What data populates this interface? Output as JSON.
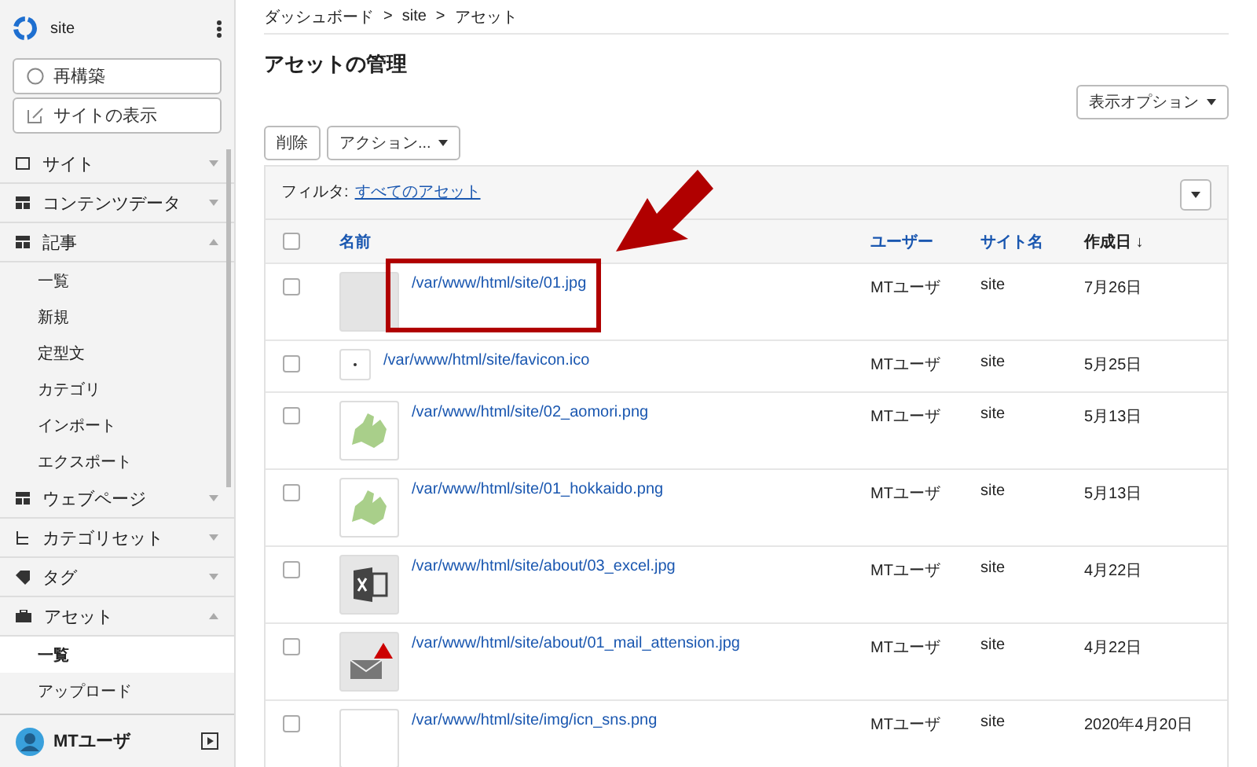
{
  "sidebar": {
    "site_name": "site",
    "buttons": [
      {
        "kind": "rebuild",
        "label": "再構築"
      },
      {
        "kind": "view",
        "label": "サイトの表示"
      }
    ],
    "items": [
      {
        "label": "サイト",
        "kind": "window",
        "expanded": false
      },
      {
        "label": "コンテンツデータ",
        "kind": "grid",
        "expanded": false
      },
      {
        "label": "記事",
        "kind": "grid",
        "expanded": true,
        "children": [
          {
            "label": "一覧",
            "selected": false
          },
          {
            "label": "新規",
            "selected": false
          },
          {
            "label": "定型文",
            "selected": false
          },
          {
            "label": "カテゴリ",
            "selected": false
          },
          {
            "label": "インポート",
            "selected": false
          },
          {
            "label": "エクスポート",
            "selected": false
          }
        ]
      },
      {
        "label": "ウェブページ",
        "kind": "grid",
        "expanded": false
      },
      {
        "label": "カテゴリセット",
        "kind": "tree",
        "expanded": false
      },
      {
        "label": "タグ",
        "kind": "tag",
        "expanded": false
      },
      {
        "label": "アセット",
        "kind": "briefcase",
        "expanded": true,
        "children": [
          {
            "label": "一覧",
            "selected": true
          },
          {
            "label": "アップロード",
            "selected": false
          }
        ]
      }
    ],
    "user": "MTユーザ"
  },
  "breadcrumb": [
    "ダッシュボード",
    "site",
    "アセット"
  ],
  "breadcrumb_separator": ">",
  "title": "アセットの管理",
  "display_options": "表示オプション",
  "actions": {
    "delete": "削除",
    "menu": "アクション..."
  },
  "filter": {
    "label": "フィルタ:",
    "value": "すべてのアセット"
  },
  "table": {
    "header_checked": false,
    "columns": [
      {
        "label": "名前",
        "link": true
      },
      {
        "label": "ユーザー",
        "link": true
      },
      {
        "label": "サイト名",
        "link": true
      },
      {
        "label": "作成日",
        "link": false,
        "sort": "↓"
      }
    ],
    "rows": [
      {
        "kind": "sample",
        "name": "/var/www/html/site/01.jpg",
        "user": "MTユーザ",
        "site": "site",
        "date": "7月26日",
        "checked": false
      },
      {
        "kind": "dot",
        "name": "/var/www/html/site/favicon.ico",
        "user": "MTユーザ",
        "site": "site",
        "date": "5月25日",
        "checked": false
      },
      {
        "kind": "map",
        "name": "/var/www/html/site/02_aomori.png",
        "user": "MTユーザ",
        "site": "site",
        "date": "5月13日",
        "checked": false
      },
      {
        "kind": "map",
        "name": "/var/www/html/site/01_hokkaido.png",
        "user": "MTユーザ",
        "site": "site",
        "date": "5月13日",
        "checked": false
      },
      {
        "kind": "excel",
        "name": "/var/www/html/site/about/03_excel.jpg",
        "user": "MTユーザ",
        "site": "site",
        "date": "4月22日",
        "checked": false
      },
      {
        "kind": "mail",
        "name": "/var/www/html/site/about/01_mail_attension.jpg",
        "user": "MTユーザ",
        "site": "site",
        "date": "4月22日",
        "checked": false
      },
      {
        "kind": "blank",
        "name": "/var/www/html/site/img/icn_sns.png",
        "user": "MTユーザ",
        "site": "site",
        "date": "2020年4月20日",
        "checked": false
      }
    ]
  }
}
